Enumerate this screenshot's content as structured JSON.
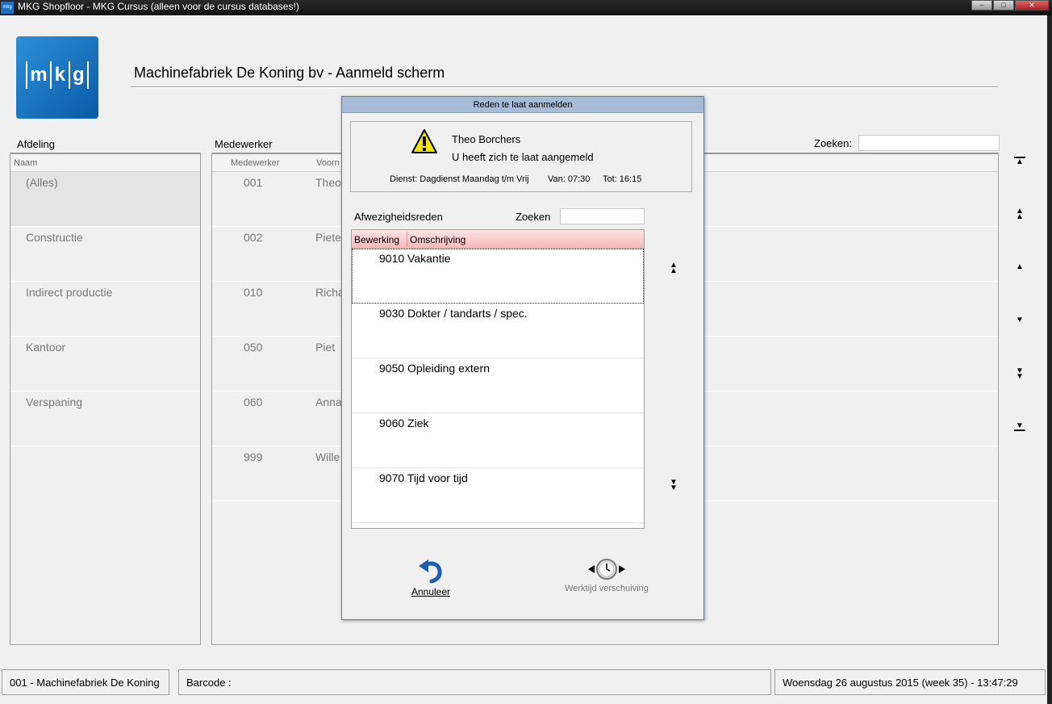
{
  "window": {
    "app_icon_text": "mkg",
    "title": "MKG Shopfloor - MKG Cursus (alleen voor de cursus databases!)",
    "buttons": {
      "minimize": "–",
      "maximize": "□",
      "close": "✕"
    }
  },
  "logo": {
    "letters": [
      "m",
      "k",
      "g"
    ]
  },
  "header": {
    "title": "Machinefabriek De Koning bv  -  Aanmeld scherm"
  },
  "afdeling": {
    "label": "Afdeling",
    "column": "Naam",
    "items": [
      "(Alles)",
      "Constructie",
      "Indirect productie",
      "Kantoor",
      "Verspaning"
    ]
  },
  "medewerker": {
    "label": "Medewerker",
    "columns": [
      "Medewerker",
      "Voorn"
    ],
    "rows": [
      {
        "code": "001",
        "name": "Theo"
      },
      {
        "code": "002",
        "name": "Piete"
      },
      {
        "code": "010",
        "name": "Richa"
      },
      {
        "code": "050",
        "name": "Piet"
      },
      {
        "code": "060",
        "name": "Anna"
      },
      {
        "code": "999",
        "name": "Wille"
      }
    ]
  },
  "search": {
    "label": "Zoeken:"
  },
  "nav": {
    "first": "▲",
    "page_up": "▲",
    "up": "▲",
    "down": "▼",
    "page_down": "▼",
    "last": "▼"
  },
  "dialog": {
    "title": "Reden te laat aanmelden",
    "warning_icon": "warning-icon",
    "employee": "Theo Borchers",
    "message": "U heeft zich te laat aangemeld",
    "shift": "Dienst: Dagdienst Maandag t/m Vrijdag",
    "van": "Van: 07:30",
    "tot": "Tot: 16:15",
    "reasons_label": "Afwezigheidsreden",
    "search_label": "Zoeken",
    "columns": [
      "Bewerking",
      "Omschrijving"
    ],
    "reasons": [
      "9010 Vakantie",
      "9030 Dokter / tandarts / spec.",
      "9050 Opleiding extern",
      "9060 Ziek",
      "9070 Tijd voor tijd"
    ],
    "cancel_label": "Annuleer",
    "shift_label": "Werktijd verschuiving"
  },
  "status": {
    "company": "001 - Machinefabriek De Koning",
    "barcode": "Barcode :",
    "datetime": "Woensdag 26 augustus 2015 (week 35)  -  13:47:29"
  }
}
